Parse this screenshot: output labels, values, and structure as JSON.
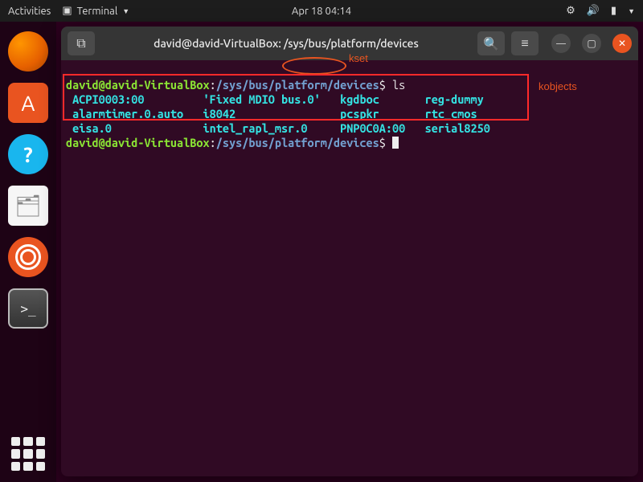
{
  "topbar": {
    "activities": "Activities",
    "app_name": "Terminal",
    "datetime": "Apr 18  04:14"
  },
  "dock": {
    "items": [
      {
        "name": "firefox-icon"
      },
      {
        "name": "software-icon"
      },
      {
        "name": "help-icon"
      },
      {
        "name": "files-icon"
      },
      {
        "name": "settings-icon"
      },
      {
        "name": "terminal-icon"
      }
    ],
    "apps_grid": "show-applications"
  },
  "window": {
    "title": "david@david-VirtualBox: /sys/bus/platform/devices",
    "newtab": "⧉",
    "search": "🔍",
    "menu": "≡",
    "minimize": "—",
    "maximize": "▢",
    "close": "✕"
  },
  "terminal": {
    "user": "david@david-VirtualBox",
    "colon": ":",
    "path_pre": "/sys/bus/",
    "path_mid": "platform",
    "path_post": "/devices",
    "dollar": "$",
    "cmd1": "ls",
    "listing": {
      "r1c1": "ACPI0003:00",
      "r1c2": "'Fixed MDIO bus.0'",
      "r1c3": "kgdboc",
      "r1c4": "reg-dummy",
      "r2c1": "alarmtimer.0.auto",
      "r2c2": "i8042",
      "r2c3": "pcspkr",
      "r2c4": "rtc_cmos",
      "r3c1": "eisa.0",
      "r3c2": "intel_rapl_msr.0",
      "r3c3": "PNP0C0A:00",
      "r3c4": "serial8250"
    }
  },
  "annotation": {
    "kset": "kset",
    "kobjects": "kobjects"
  }
}
